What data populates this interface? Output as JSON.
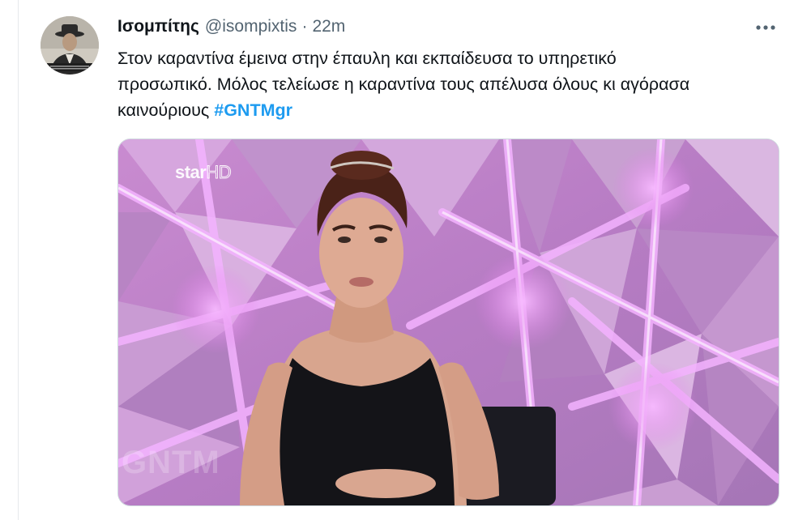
{
  "tweet": {
    "author": {
      "display_name": "Ισομπίτης",
      "handle": "@isompixtis",
      "separator": "·",
      "time": "22m",
      "avatar": "user-avatar"
    },
    "text": {
      "line1": "Στον καραντίνα έμεινα στην έπαυλη και εκπαίδευσα το υπηρετικό",
      "line2": "προσωπικό. Μόλος τελείωσε η καραντίνα τους απέλυσα όλους κι αγόρασα",
      "line3": "καινούριους",
      "hashtag": "#GNTMgr"
    },
    "more_icon": "more-horizontal-icon",
    "media": {
      "channel_logo": "star",
      "channel_logo_suffix": "HD",
      "show_watermark": "GNTM"
    }
  },
  "colors": {
    "text": "#0f1419",
    "secondary": "#536471",
    "link": "#1d9bf0",
    "media_accent": "#e07ee8"
  }
}
